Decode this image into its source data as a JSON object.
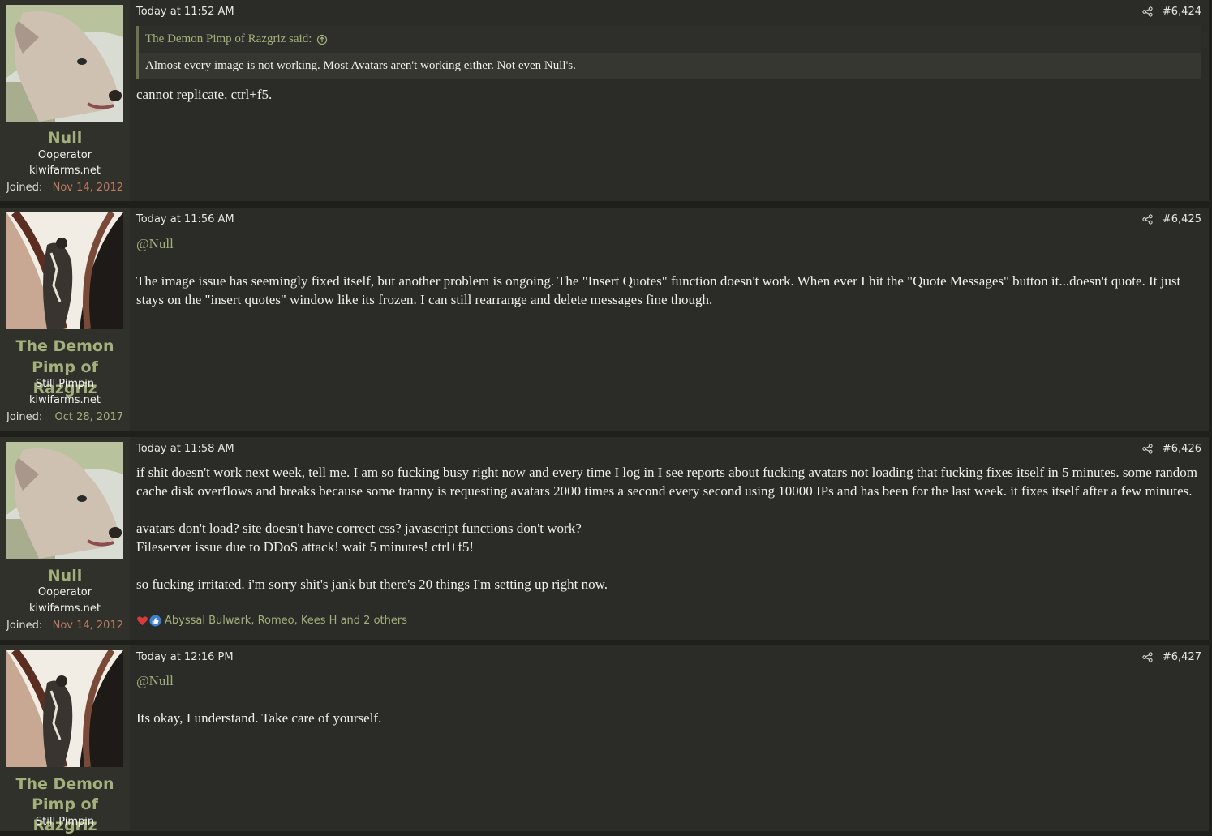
{
  "posts": [
    {
      "author": "Null",
      "user_title": "Ooperator",
      "user_site": "kiwifarms.net",
      "joined_label": "Joined:",
      "joined_date": "Nov 14, 2012",
      "time": "Today at 11:52 AM",
      "post_number": "#6,424",
      "quote": {
        "attribution": "The Demon Pimp of Razgriz said:",
        "text": "Almost every image is not working. Most Avatars aren't working either. Not even Null's."
      },
      "paragraphs": [
        "cannot replicate. ctrl+f5."
      ]
    },
    {
      "author_line1": "The Demon",
      "author_line2": "Pimp of Razgriz",
      "user_title": "Still Pimpin",
      "user_site": "kiwifarms.net",
      "joined_label": "Joined:",
      "joined_date": "Oct 28, 2017",
      "time": "Today at 11:56 AM",
      "post_number": "#6,425",
      "mention": "@Null",
      "paragraphs": [
        "The image issue has seemingly fixed itself, but another problem is ongoing. The \"Insert Quotes\" function doesn't work. When ever I hit the \"Quote Messages\" button it...doesn't quote. It just stays on the \"insert quotes\" window like its frozen. I can still rearrange and delete messages fine though."
      ]
    },
    {
      "author": "Null",
      "user_title": "Ooperator",
      "user_site": "kiwifarms.net",
      "joined_label": "Joined:",
      "joined_date": "Nov 14, 2012",
      "time": "Today at 11:58 AM",
      "post_number": "#6,426",
      "paragraphs": [
        "if shit doesn't work next week, tell me. I am so fucking busy right now and every time I log in I see reports about fucking avatars not loading that fucking fixes itself in 5 minutes. some random cache disk overflows and breaks because some tranny is requesting avatars 2000 times a second every second using 10000 IPs and has been for the last week. it fixes itself after a few minutes.",
        "avatars don't load? site doesn't have correct css? javascript functions don't work?",
        "Fileserver issue due to DDoS attack! wait 5 minutes! ctrl+f5!",
        "so fucking irritated. i'm sorry shit's jank but there's 20 things I'm setting up right now."
      ],
      "reactions_text": "Abyssal Bulwark, Romeo, Kees H and 2 others"
    },
    {
      "author_line1": "The Demon",
      "author_line2": "Pimp of Razgriz",
      "user_title": "Still Pimpin",
      "time": "Today at 12:16 PM",
      "post_number": "#6,427",
      "mention": "@Null",
      "paragraphs": [
        "Its okay, I understand. Take care of yourself."
      ]
    }
  ],
  "icons": {
    "share": "share-icon",
    "quote_jump": "arrow-up-circle-icon",
    "reaction_love": "heart-icon",
    "reaction_like": "thumbs-up-icon"
  },
  "colors": {
    "accent": "#a3b07c",
    "post_bg": "#2b2c27",
    "userpane_bg": "#30312b",
    "joined_date_null": "#c07c62"
  }
}
